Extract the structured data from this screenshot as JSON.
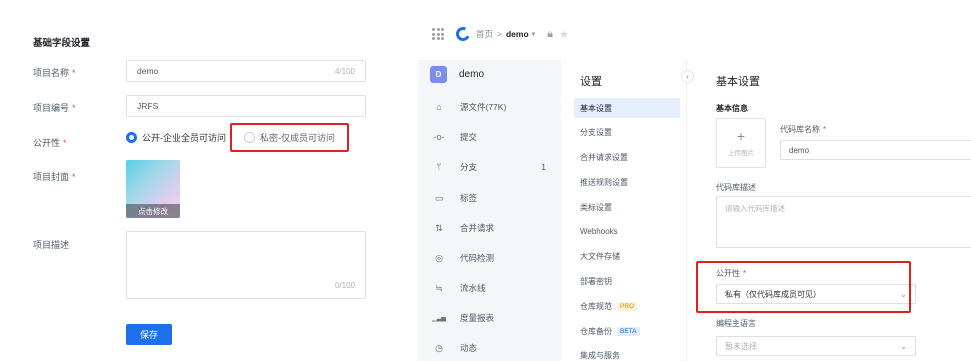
{
  "left_form": {
    "section_title": "基础字段设置",
    "name": {
      "label": "项目名称",
      "required": "*",
      "value": "demo",
      "counter": "4/100"
    },
    "code": {
      "label": "项目编号",
      "required": "*",
      "value": "JRFS"
    },
    "visibility": {
      "label": "公开性",
      "required": "*",
      "options": [
        "公开-企业全员可访问",
        "私密-仅成员可访问"
      ],
      "selected_index": 0
    },
    "cover": {
      "label": "项目封面",
      "required": "*",
      "edit_label": "点击修改"
    },
    "description": {
      "label": "项目描述",
      "counter": "0/100"
    },
    "save_label": "保存"
  },
  "topbar": {
    "breadcrumb_home": "首页",
    "breadcrumb_sep": ">",
    "breadcrumb_current": "demo",
    "caret": "▾"
  },
  "repo_nav": {
    "badge": "D",
    "repo_name": "demo",
    "items": [
      {
        "label": "源文件(77K)",
        "icon": "code-icon",
        "glyph": "⌂"
      },
      {
        "label": "提交",
        "icon": "commit-icon",
        "glyph": "-o-"
      },
      {
        "label": "分支",
        "icon": "branch-icon",
        "glyph": "ᛘ",
        "count": "1"
      },
      {
        "label": "标签",
        "icon": "tag-icon",
        "glyph": "▭"
      },
      {
        "label": "合并请求",
        "icon": "merge-request-icon",
        "glyph": "⇅"
      },
      {
        "label": "代码检测",
        "icon": "scan-icon",
        "glyph": "◎"
      },
      {
        "label": "流水线",
        "icon": "pipeline-icon",
        "glyph": "≒"
      },
      {
        "label": "度量报表",
        "icon": "chart-icon",
        "glyph": "▁▃▅"
      },
      {
        "label": "动态",
        "icon": "activity-icon",
        "glyph": "◷"
      }
    ]
  },
  "settings_nav": {
    "title": "设置",
    "items": [
      {
        "label": "基本设置",
        "active": true
      },
      {
        "label": "分支设置"
      },
      {
        "label": "合并请求设置"
      },
      {
        "label": "推送规则设置"
      },
      {
        "label": "类标设置"
      },
      {
        "label": "Webhooks"
      },
      {
        "label": "大文件存储"
      },
      {
        "label": "部署密钥"
      },
      {
        "label": "仓库规范",
        "tag": "PRO"
      },
      {
        "label": "仓库备份",
        "tag": "BETA"
      },
      {
        "label": "集成与服务"
      }
    ],
    "collapse_glyph": "‹"
  },
  "content": {
    "title": "基本设置",
    "subtitle": "基本信息",
    "upload_plus": "+",
    "upload_label": "上传图片",
    "repo_name_label": "代码库名称",
    "repo_name_required": "*",
    "repo_name_value": "demo",
    "desc_label": "代码库描述",
    "desc_placeholder": "请输入代码库描述",
    "visibility_label": "公开性",
    "visibility_required": "*",
    "visibility_value": "私有（仅代码库成员可见）",
    "language_label": "编程主语言",
    "language_placeholder": "暂未选择"
  },
  "colors": {
    "primary": "#1f6feb",
    "highlight_box": "#e02020",
    "required": "#e84e4e"
  }
}
